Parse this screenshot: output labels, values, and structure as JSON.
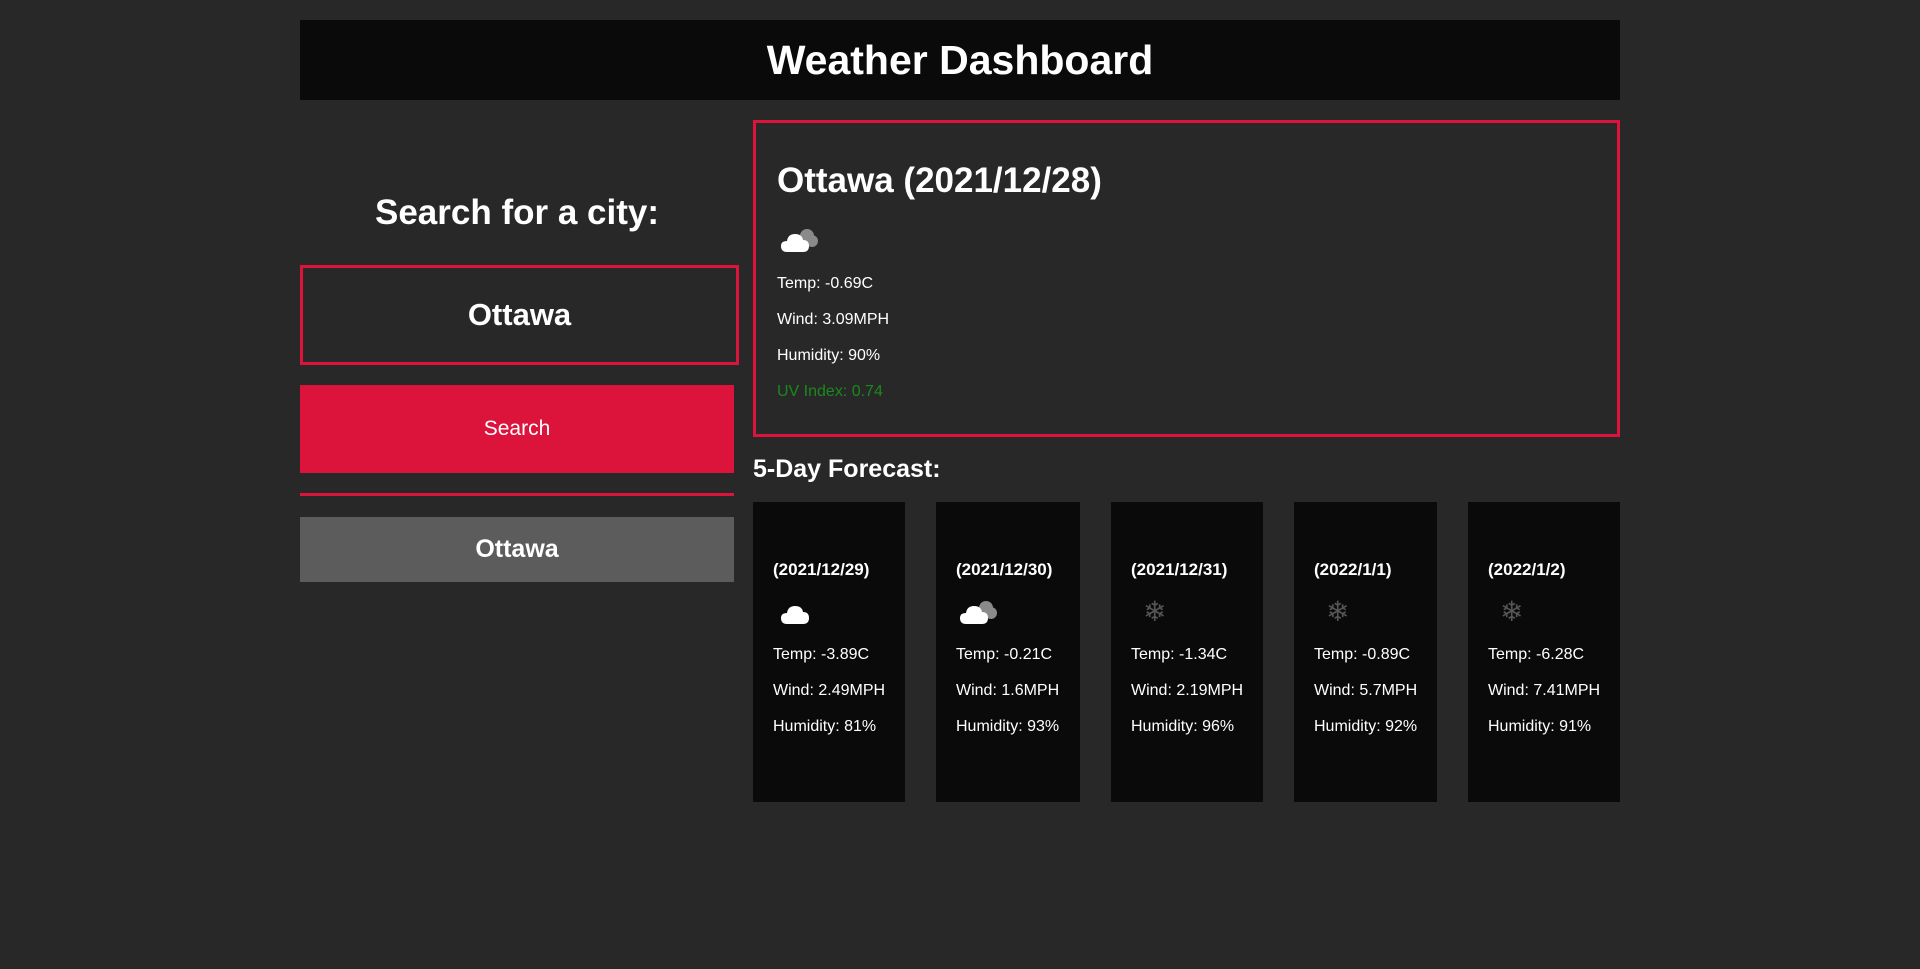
{
  "header": {
    "title": "Weather Dashboard"
  },
  "search": {
    "heading": "Search for a city:",
    "input_value": "Ottawa",
    "button_label": "Search",
    "history": [
      "Ottawa"
    ]
  },
  "current": {
    "title": "Ottawa (2021/12/28)",
    "icon": "cloudy-icon",
    "temp": "Temp: -0.69C",
    "wind": "Wind: 3.09MPH",
    "humidity": "Humidity: 90%",
    "uv": "UV Index: 0.74",
    "uv_color": "#1a8a1a"
  },
  "forecast": {
    "heading": "5-Day Forecast:",
    "days": [
      {
        "date": "(2021/12/29)",
        "icon": "cloud-icon",
        "temp": "Temp: -3.89C",
        "wind": "Wind: 2.49MPH",
        "humidity": "Humidity: 81%"
      },
      {
        "date": "(2021/12/30)",
        "icon": "cloudy-icon",
        "temp": "Temp: -0.21C",
        "wind": "Wind: 1.6MPH",
        "humidity": "Humidity: 93%"
      },
      {
        "date": "(2021/12/31)",
        "icon": "snow-icon",
        "temp": "Temp: -1.34C",
        "wind": "Wind: 2.19MPH",
        "humidity": "Humidity: 96%"
      },
      {
        "date": "(2022/1/1)",
        "icon": "snow-icon",
        "temp": "Temp: -0.89C",
        "wind": "Wind: 5.7MPH",
        "humidity": "Humidity: 92%"
      },
      {
        "date": "(2022/1/2)",
        "icon": "snow-icon",
        "temp": "Temp: -6.28C",
        "wind": "Wind: 7.41MPH",
        "humidity": "Humidity: 91%"
      }
    ]
  },
  "colors": {
    "accent": "#dc143c",
    "panel": "#0a0a0a",
    "background": "#282828",
    "history_button": "#5c5c5c"
  }
}
